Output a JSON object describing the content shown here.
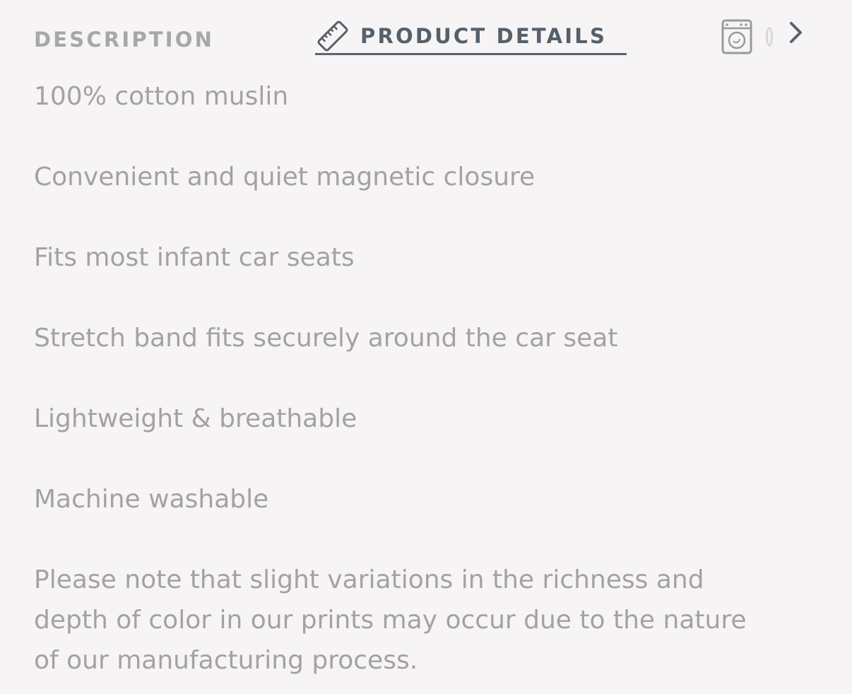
{
  "tabs": {
    "description_label": "DESCRIPTION",
    "product_details_label": "PRODUCT DETAILS",
    "active": "PRODUCT DETAILS",
    "icons": {
      "product_details": "ruler-icon",
      "care": "washing-machine-icon",
      "partial": "partial-tab-icon",
      "next": "chevron-right-icon"
    }
  },
  "details": {
    "items": [
      "100% cotton muslin",
      "Convenient and quiet magnetic closure",
      "Fits most infant car seats",
      "Stretch band fits securely around the car seat",
      "Lightweight & breathable",
      "Machine washable"
    ],
    "note": "Please note that slight variations in the richness and depth of color in our prints may occur due to the nature of our manufacturing process."
  },
  "colors": {
    "background": "#f6f4f5",
    "active_tab": "#56606b",
    "inactive_tab": "#a7a6a8",
    "body_text": "#a3a1a4"
  }
}
